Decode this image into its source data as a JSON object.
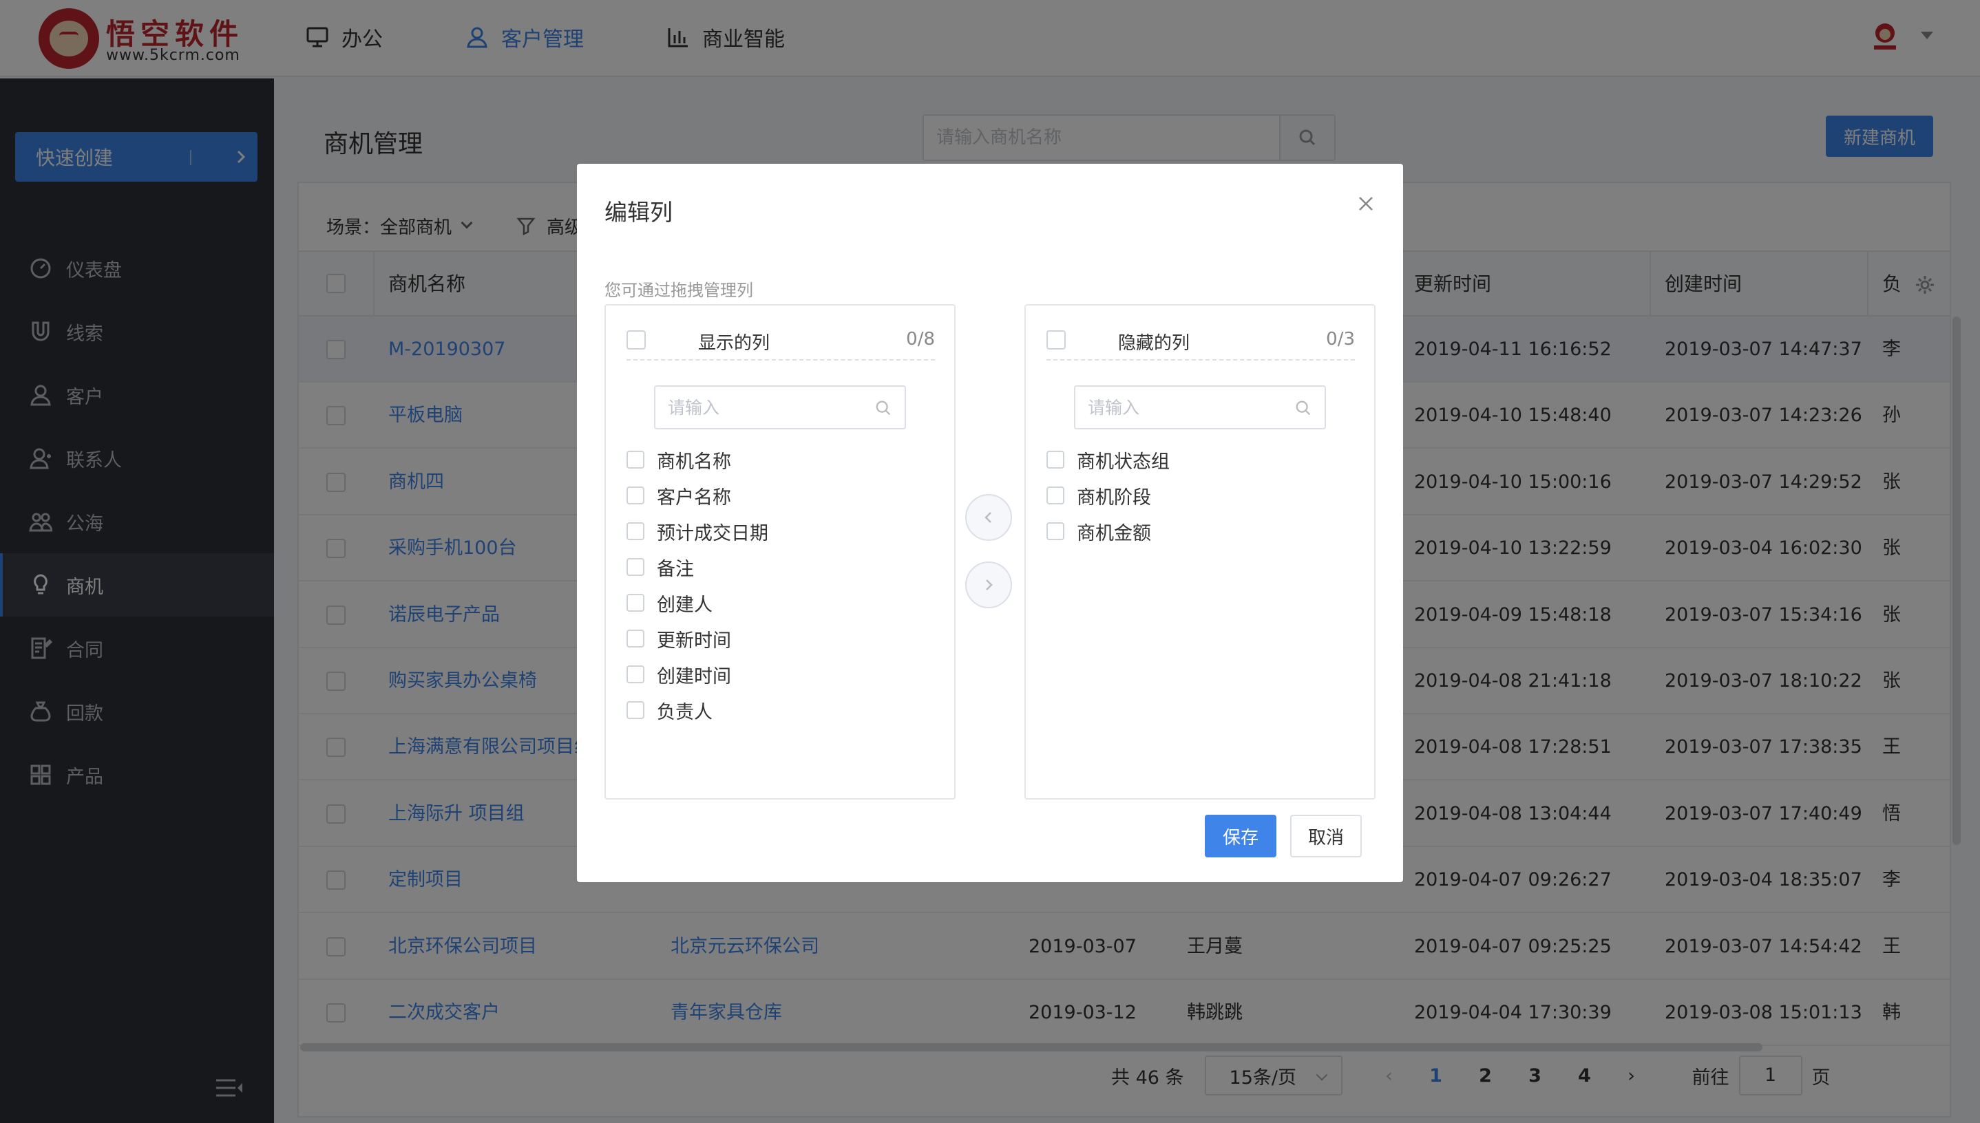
{
  "brand": {
    "name": "悟空软件",
    "url": "www.5kcrm.com"
  },
  "nav": [
    {
      "label": "办公",
      "icon": "monitor-icon"
    },
    {
      "label": "客户管理",
      "icon": "user-icon",
      "active": true
    },
    {
      "label": "商业智能",
      "icon": "bar-chart-icon"
    }
  ],
  "sidebar": {
    "quick_create": "快速创建",
    "items": [
      {
        "label": "仪表盘",
        "icon": "dashboard-icon"
      },
      {
        "label": "线索",
        "icon": "magnet-icon"
      },
      {
        "label": "客户",
        "icon": "customer-icon"
      },
      {
        "label": "联系人",
        "icon": "contact-icon"
      },
      {
        "label": "公海",
        "icon": "group-icon"
      },
      {
        "label": "商机",
        "icon": "lightbulb-icon",
        "active": true
      },
      {
        "label": "合同",
        "icon": "contract-icon"
      },
      {
        "label": "回款",
        "icon": "money-bag-icon"
      },
      {
        "label": "产品",
        "icon": "product-icon"
      }
    ]
  },
  "page": {
    "title": "商机管理",
    "search_placeholder": "请输入商机名称",
    "new_button": "新建商机",
    "scene_filter": "场景：全部商机",
    "advanced_filter": "高级筛选"
  },
  "table": {
    "columns": {
      "name": "商机名称",
      "updated": "更新时间",
      "created": "创建时间",
      "owner": "负"
    },
    "rows": [
      {
        "name": "M-20190307",
        "customer": "",
        "date": "",
        "creator": "",
        "updated": "2019-04-11 16:16:52",
        "created": "2019-03-07 14:47:37",
        "owner": "李"
      },
      {
        "name": "平板电脑",
        "customer": "",
        "date": "",
        "creator": "",
        "updated": "2019-04-10 15:48:40",
        "created": "2019-03-07 14:23:26",
        "owner": "孙"
      },
      {
        "name": "商机四",
        "customer": "",
        "date": "",
        "creator": "",
        "updated": "2019-04-10 15:00:16",
        "created": "2019-03-07 14:29:52",
        "owner": "张"
      },
      {
        "name": "采购手机100台",
        "customer": "",
        "date": "",
        "creator": "",
        "updated": "2019-04-10 13:22:59",
        "created": "2019-03-04 16:02:30",
        "owner": "张"
      },
      {
        "name": "诺辰电子产品",
        "customer": "",
        "date": "",
        "creator": "",
        "updated": "2019-04-09 15:48:18",
        "created": "2019-03-07 15:34:16",
        "owner": "张"
      },
      {
        "name": "购买家具办公桌椅",
        "customer": "",
        "date": "",
        "creator": "",
        "updated": "2019-04-08 21:41:18",
        "created": "2019-03-07 18:10:22",
        "owner": "张"
      },
      {
        "name": "上海满意有限公司项目组",
        "customer": "",
        "date": "",
        "creator": "",
        "updated": "2019-04-08 17:28:51",
        "created": "2019-03-07 17:38:35",
        "owner": "王"
      },
      {
        "name": "上海际升 项目组",
        "customer": "",
        "date": "",
        "creator": "",
        "updated": "2019-04-08 13:04:44",
        "created": "2019-03-07 17:40:49",
        "owner": "悟"
      },
      {
        "name": "定制项目",
        "customer": "",
        "date": "",
        "creator": "",
        "updated": "2019-04-07 09:26:27",
        "created": "2019-03-04 18:35:07",
        "owner": "李"
      },
      {
        "name": "北京环保公司项目",
        "customer": "北京元云环保公司",
        "date": "2019-03-07",
        "creator": "王月蔓",
        "updated": "2019-04-07 09:25:25",
        "created": "2019-03-07 14:54:42",
        "owner": "王"
      },
      {
        "name": "二次成交客户",
        "customer": "青年家具仓库",
        "date": "2019-03-12",
        "creator": "韩跳跳",
        "updated": "2019-04-04 17:30:39",
        "created": "2019-03-08 15:01:13",
        "owner": "韩"
      }
    ]
  },
  "pagination": {
    "total": "共 46 条",
    "page_size": "15条/页",
    "pages": [
      "1",
      "2",
      "3",
      "4"
    ],
    "current": "1",
    "goto_label": "前往",
    "goto_value": "1",
    "goto_suffix": "页"
  },
  "dialog": {
    "title": "编辑列",
    "tip": "您可通过拖拽管理列",
    "visible": {
      "title": "显示的列",
      "count": "0/8",
      "placeholder": "请输入",
      "items": [
        "商机名称",
        "客户名称",
        "预计成交日期",
        "备注",
        "创建人",
        "更新时间",
        "创建时间",
        "负责人"
      ]
    },
    "hidden": {
      "title": "隐藏的列",
      "count": "0/3",
      "placeholder": "请输入",
      "items": [
        "商机状态组",
        "商机阶段",
        "商机金额"
      ]
    },
    "save": "保存",
    "cancel": "取消"
  },
  "colors": {
    "accent": "#3e84e9",
    "sidebar": "#2d3037",
    "brand": "#c0262c"
  }
}
